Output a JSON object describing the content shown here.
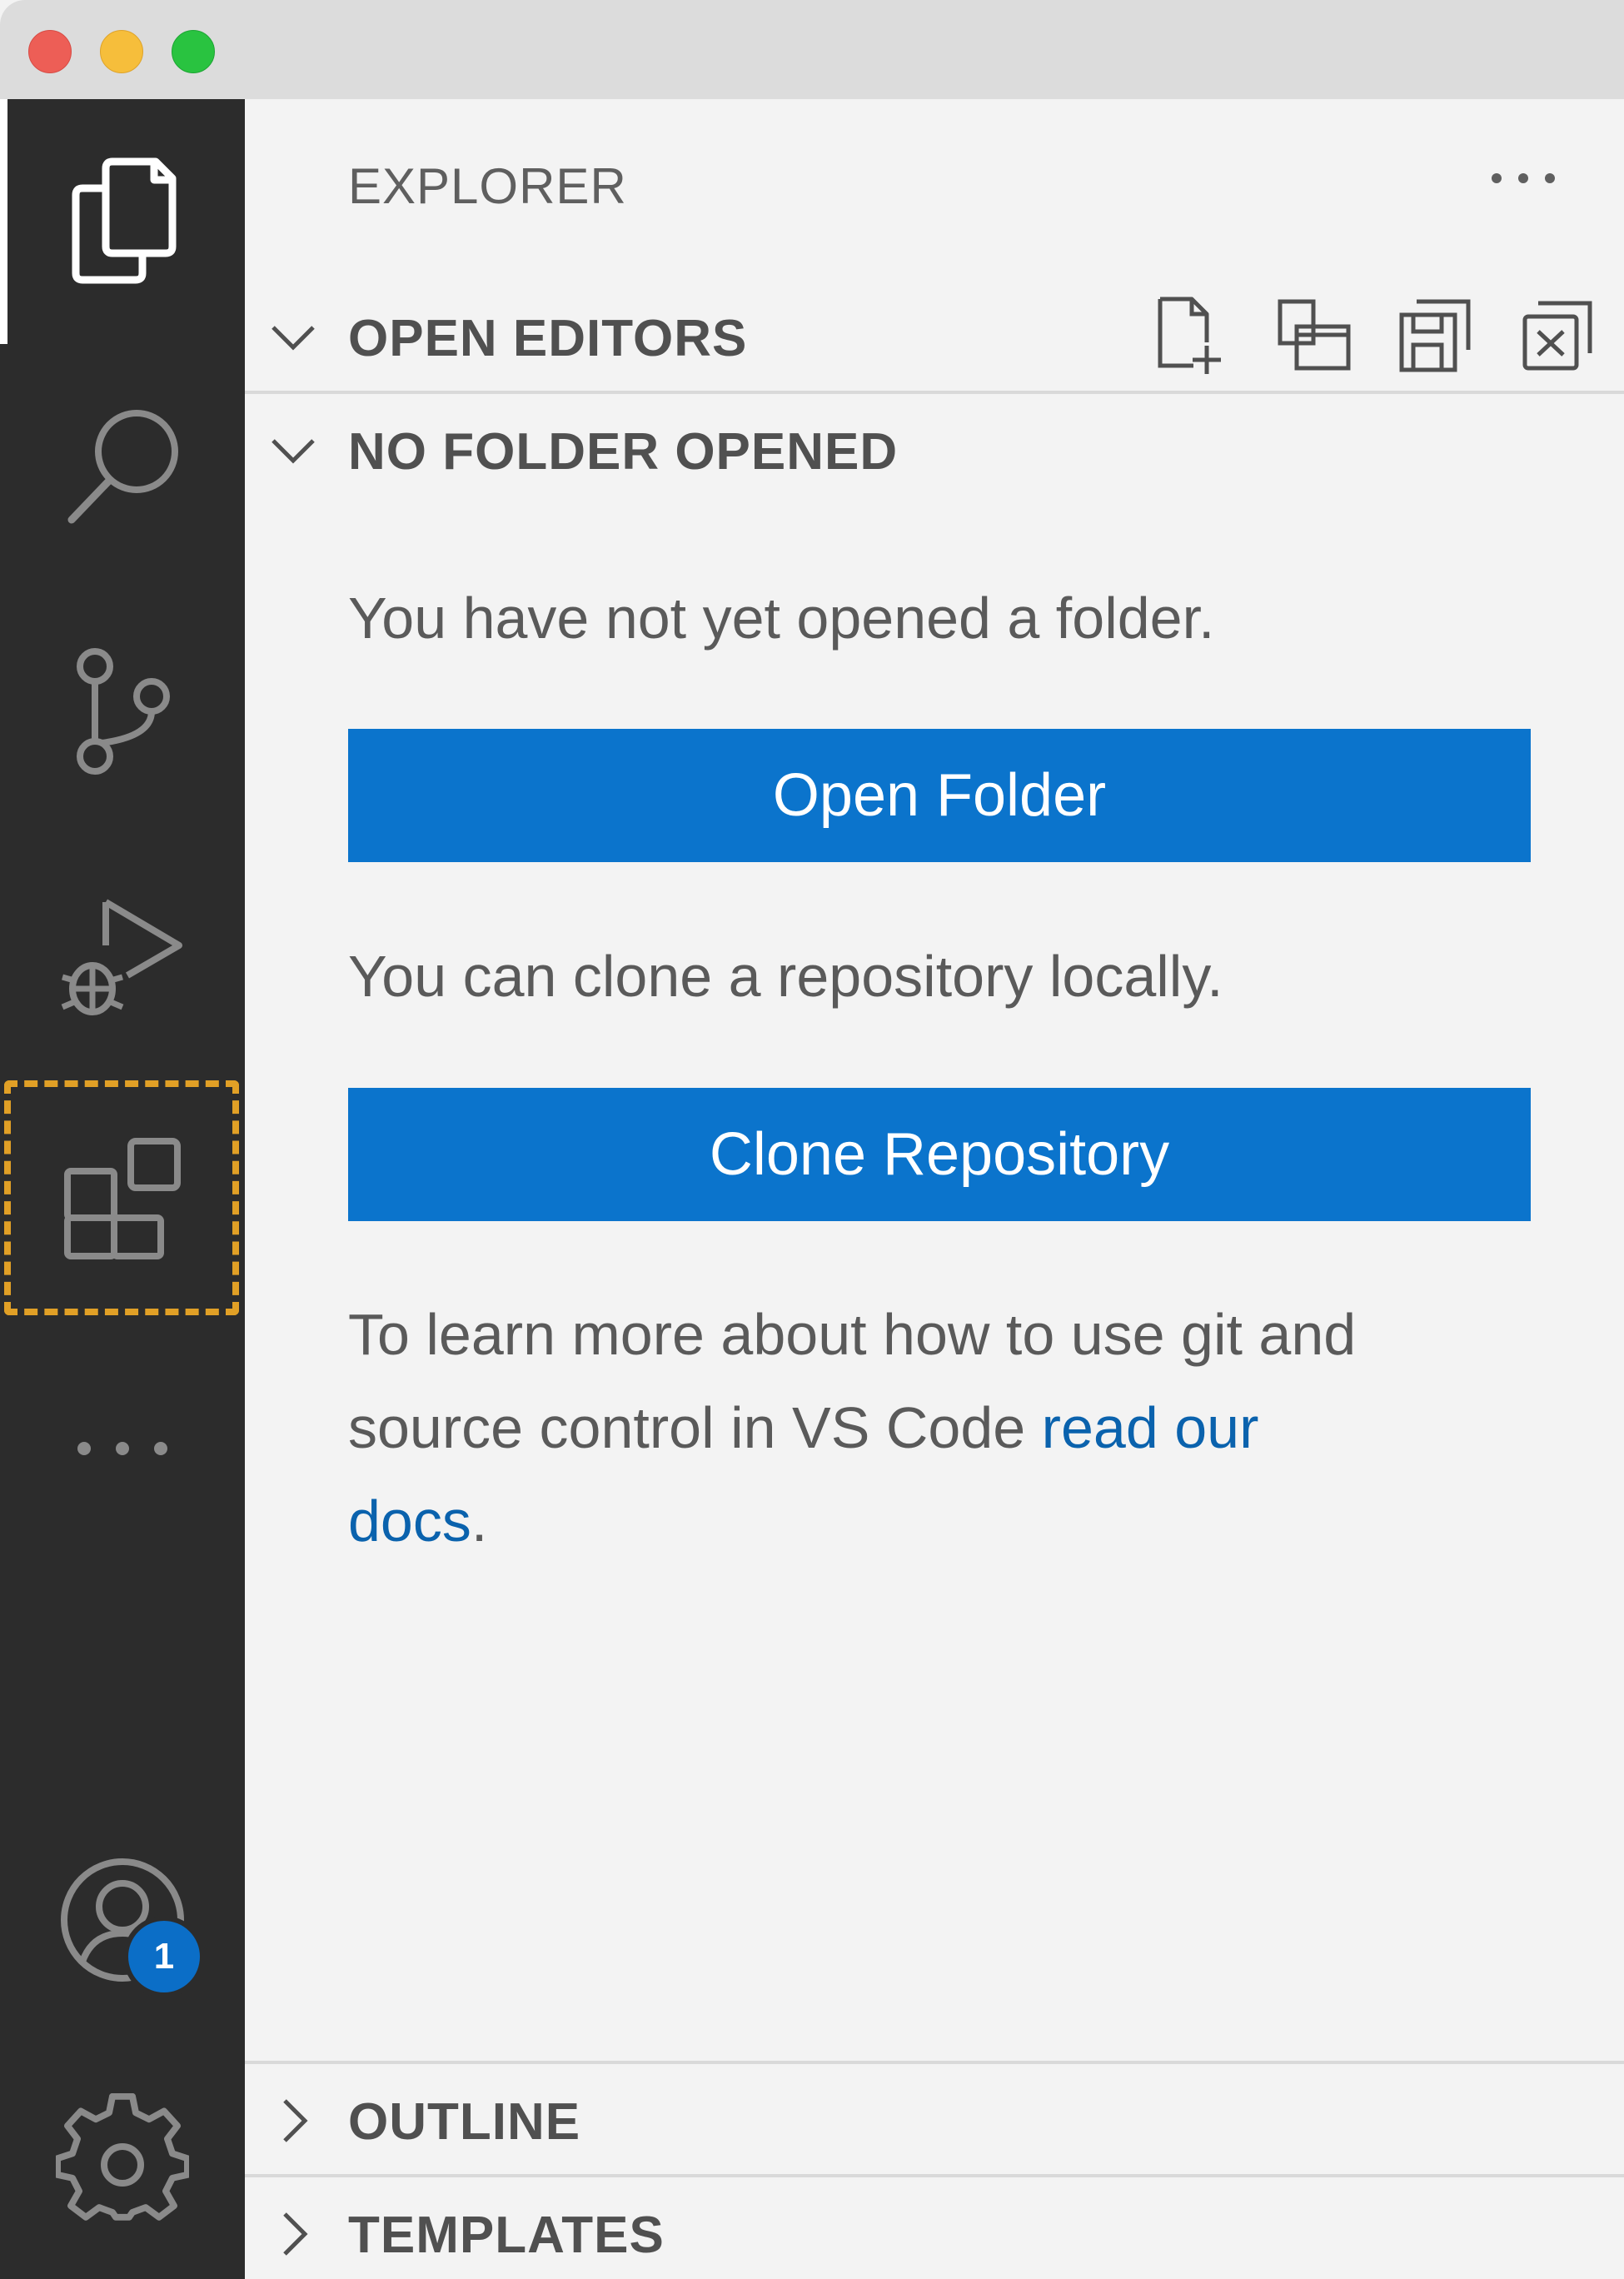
{
  "window": {
    "traffic_lights": [
      "close",
      "minimize",
      "maximize"
    ]
  },
  "activity_bar": {
    "items": [
      {
        "name": "explorer",
        "icon": "files-icon",
        "active": true
      },
      {
        "name": "search",
        "icon": "search-icon"
      },
      {
        "name": "source-control",
        "icon": "source-control-icon"
      },
      {
        "name": "run-and-debug",
        "icon": "run-debug-icon"
      },
      {
        "name": "extensions",
        "icon": "extensions-icon",
        "highlighted": true
      },
      {
        "name": "more",
        "icon": "more-icon"
      }
    ],
    "bottom_items": [
      {
        "name": "accounts",
        "icon": "account-icon",
        "badge": "1"
      },
      {
        "name": "manage",
        "icon": "gear-icon"
      }
    ],
    "accounts_badge": "1",
    "highlight_color": "#e1a026"
  },
  "sidebar": {
    "title": "EXPLORER",
    "more_icon": "ellipsis-icon",
    "open_editors": {
      "label": "OPEN EDITORS",
      "tools": [
        "new-file-icon",
        "toggle-vertical-icon",
        "save-all-icon",
        "close-all-icon"
      ]
    },
    "no_folder": {
      "label": "NO FOLDER OPENED",
      "message_open": "You have not yet opened a folder.",
      "open_folder_button": "Open Folder",
      "message_clone": "You can clone a repository locally.",
      "clone_button": "Clone Repository",
      "learn_line1": "To learn more about how to use git and",
      "learn_line2_prefix": "source control in VS Code ",
      "learn_link_part1": "read our",
      "learn_link_part2": "docs",
      "learn_suffix": "."
    },
    "outline": {
      "label": "OUTLINE"
    },
    "templates": {
      "label": "TEMPLATES"
    }
  },
  "colors": {
    "button_bg": "#0b74cc",
    "link": "#0a62ad",
    "activity_bar_bg": "#2c2c2c",
    "badge_bg": "#0b6ec7"
  }
}
